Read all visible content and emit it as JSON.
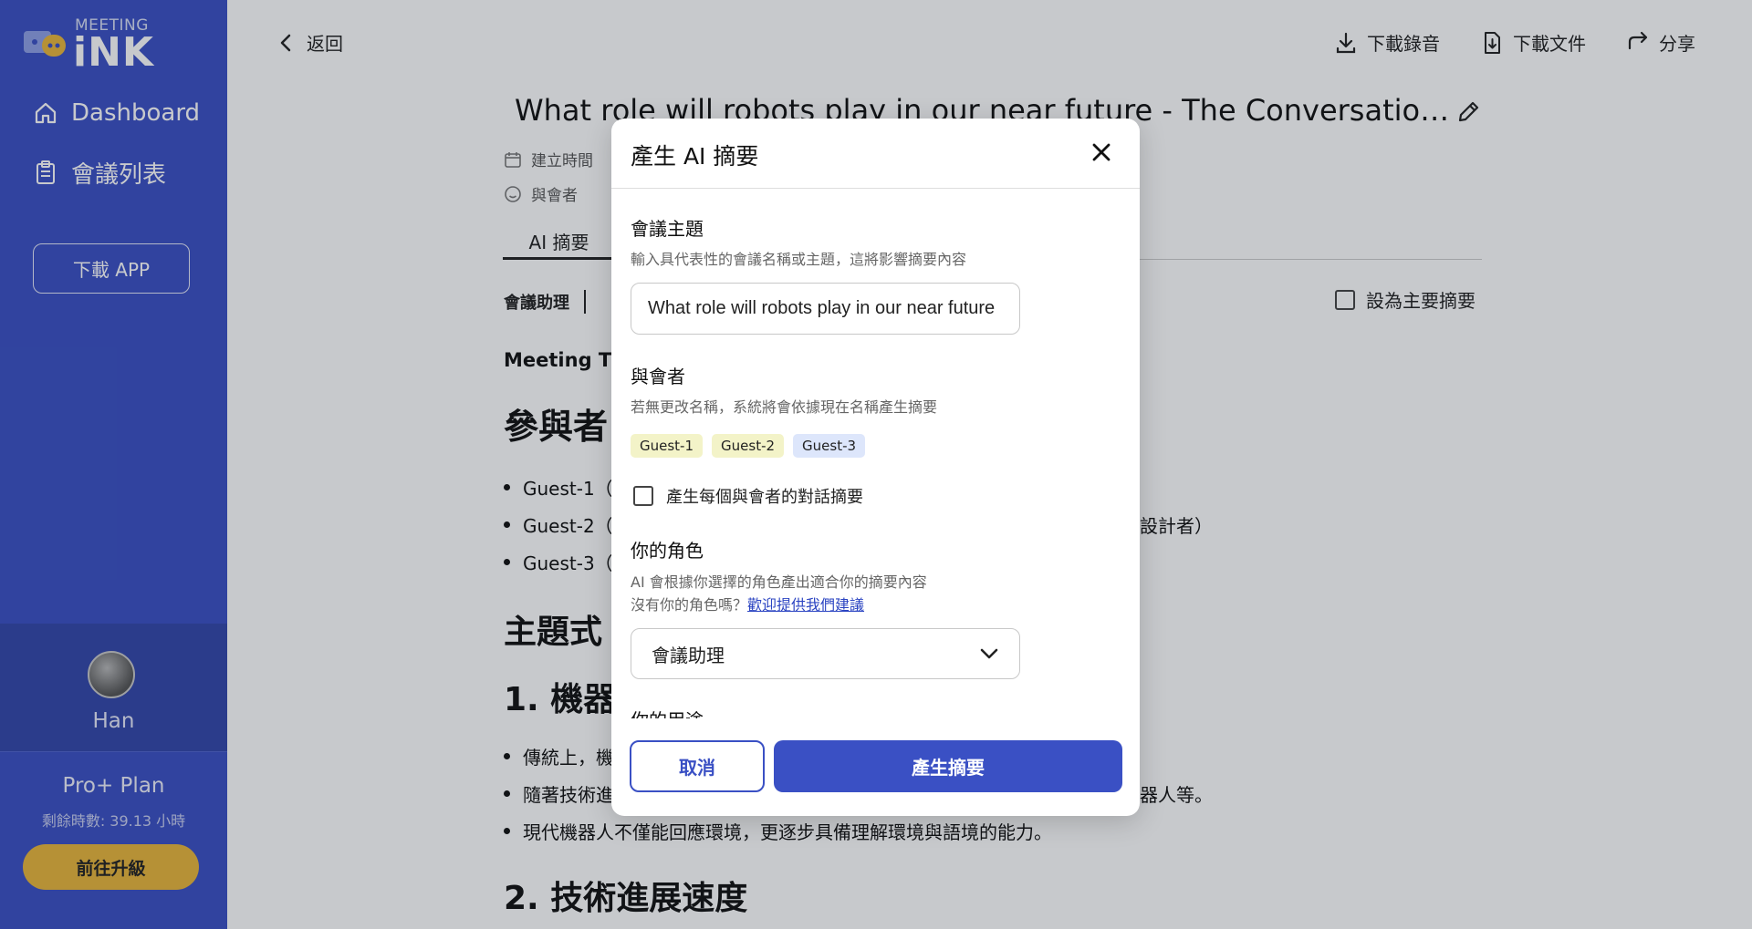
{
  "sidebar": {
    "logo_top": "MEETING",
    "logo_main": "iNK",
    "nav": [
      {
        "label": "Dashboard"
      },
      {
        "label": "會議列表"
      }
    ],
    "download_app": "下載 APP",
    "user_name": "Han",
    "plan_name": "Pro+ Plan",
    "remaining": "剩餘時數: 39.13 小時",
    "upgrade": "前往升級"
  },
  "header": {
    "back": "返回",
    "actions": [
      {
        "label": "下載錄音",
        "icon": "download-icon"
      },
      {
        "label": "下載文件",
        "icon": "file-download-icon"
      },
      {
        "label": "分享",
        "icon": "share-icon"
      }
    ]
  },
  "doc": {
    "title": "What role will robots play in our near future - The Conversation podcast",
    "meta_created": "建立時間",
    "meta_participants": "與會者",
    "tab_active": "AI 摘要",
    "role_label": "會議助理",
    "primary_summary": "設為主要摘要",
    "meeting_time": "Meeting Tim",
    "h_participants": "參與者",
    "bullets": [
      "Guest-1（",
      "Guest-2（",
      "Guest-3（"
    ],
    "bullet_tail": "設計者）",
    "h_topic": "主題式",
    "h_robot": "1. 機器",
    "content_bullets": [
      "傳統上，機",
      "隨著技術進",
      "現代機器人不僅能回應環境，更逐步具備理解環境與語境的能力。"
    ],
    "bullet2_tail": "器人等。",
    "h_tech": "2. 技術進展速度"
  },
  "modal": {
    "title": "產生 AI 摘要",
    "topic_label": "會議主題",
    "topic_hint": "輸入具代表性的會議名稱或主題，這將影響摘要內容",
    "topic_value": "What role will robots play in our near future",
    "participants_label": "與會者",
    "participants_hint": "若無更改名稱，系統將會依據現在名稱產生摘要",
    "tags": [
      {
        "label": "Guest-1",
        "color": "#f3f3c8"
      },
      {
        "label": "Guest-2",
        "color": "#f3f3c8"
      },
      {
        "label": "Guest-3",
        "color": "#dde6fb"
      }
    ],
    "each_summary": "產生每個與會者的對話摘要",
    "role_label": "你的角色",
    "role_hint": "AI 會根據你選擇的角色產出適合你的摘要內容",
    "role_hint2_prefix": "沒有你的角色嗎？",
    "role_hint2_link": "歡迎提供我們建議",
    "role_value": "會議助理",
    "purpose_label": "你的用途",
    "cancel": "取消",
    "generate": "產生摘要"
  },
  "colors": {
    "primary": "#3a50c4",
    "upgrade": "#e9b63a"
  }
}
